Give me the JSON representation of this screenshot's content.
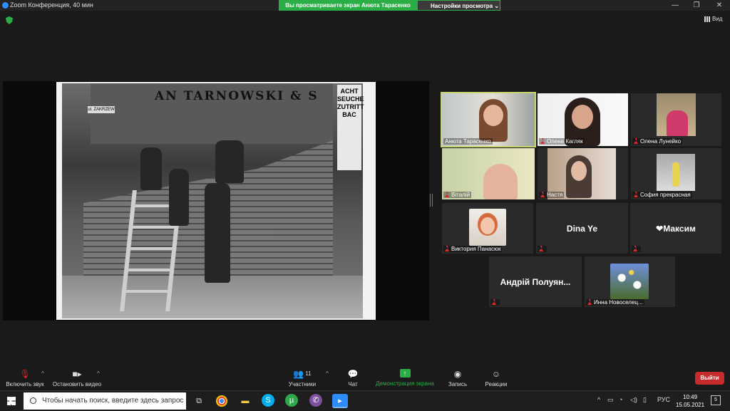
{
  "window": {
    "title": "Zoom Конференция, 40 мин",
    "share_banner": "Вы просматриваете экран Анюта Тарасенко",
    "view_options": "Настройки просмотра",
    "view_label": "Вид"
  },
  "shared_content": {
    "shop_sign": "AN TARNOWSKI & S",
    "street_sign": "ul. ZAKRZEW",
    "poster": "ACHT SEUCHE ZUTRITT BAC"
  },
  "participants": [
    {
      "name": "Анюта Тарасенко",
      "muted": false,
      "video": true,
      "active": true
    },
    {
      "name": "Олена Кагляк",
      "muted": true,
      "video": true
    },
    {
      "name": "Олена Лунейко",
      "muted": true,
      "video": true
    },
    {
      "name": "Віталій",
      "muted": true,
      "video": true
    },
    {
      "name": "Настя",
      "muted": true,
      "video": true
    },
    {
      "name": "София прекрасная",
      "muted": true,
      "video": true
    },
    {
      "name": "Виктория Панасюк",
      "muted": true,
      "video": false
    },
    {
      "name": "Dina Ye",
      "muted": true,
      "video": false
    },
    {
      "name": "❤Максим",
      "muted": true,
      "video": false
    },
    {
      "name": "Андрій Полуян...",
      "muted": true,
      "video": false
    },
    {
      "name": "Инна Новоселец...",
      "muted": true,
      "video": false
    }
  ],
  "toolbar": {
    "unmute": "Включить звук",
    "stop_video": "Остановить видео",
    "participants": "Участники",
    "participants_count": "11",
    "chat": "Чат",
    "share_screen": "Демонстрация экрана",
    "record": "Запись",
    "reactions": "Реакции",
    "leave": "Выйти"
  },
  "taskbar": {
    "search_placeholder": "Чтобы начать поиск, введите здесь запрос",
    "language": "РУС",
    "time": "10:49",
    "date": "15.05.2021",
    "notifications": "5"
  },
  "colors": {
    "accent_green": "#2cae46",
    "leave_red": "#c72c2c",
    "active_speaker": "#c7d66e"
  }
}
